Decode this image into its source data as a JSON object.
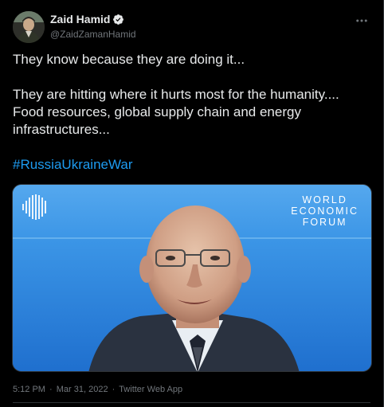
{
  "tweet": {
    "author": {
      "display_name": "Zaid Hamid",
      "handle": "@ZaidZamanHamid",
      "verified": true,
      "avatar_icon": "avatar-photo"
    },
    "more_icon": "ellipsis-icon",
    "paragraphs": [
      "They know because they are doing  it...",
      "They are hitting where it hurts most for the humanity.... Food resources, global supply chain and energy infrastructures..."
    ],
    "hashtag": "#RussiaUkraineWar",
    "media": {
      "logo_lines": [
        "WORLD",
        "ECONOMIC",
        "FORUM"
      ],
      "background_color": "#2b86df"
    },
    "time": "5:12 PM",
    "separator": "·",
    "date": "Mar 31, 2022",
    "source": "Twitter Web App"
  },
  "colors": {
    "background": "#000000",
    "text": "#e7e9ea",
    "muted": "#71767b",
    "accent": "#1d9bf0"
  }
}
